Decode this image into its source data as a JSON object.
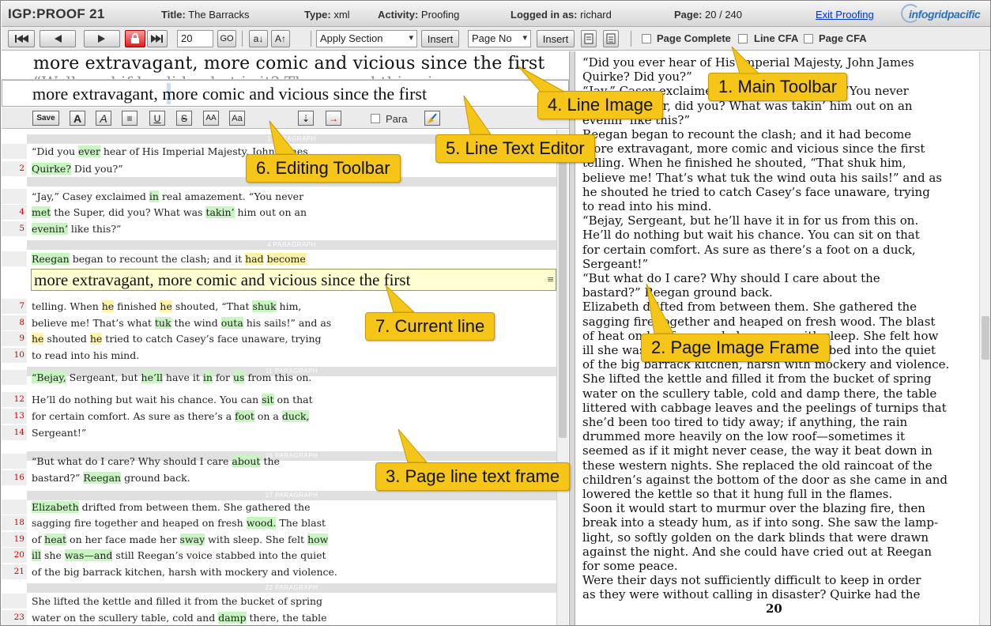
{
  "header": {
    "app_name": "IGP:PROOF 21",
    "title_label": "Title:",
    "title_value": "The Barracks",
    "type_label": "Type:",
    "type_value": "xml",
    "activity_label": "Activity:",
    "activity_value": "Proofing",
    "logged_label": "Logged in as:",
    "logged_value": "richard",
    "page_label": "Page:",
    "page_value": "20 / 240",
    "exit_link": "Exit Proofing",
    "logo_text": "infogridpacific"
  },
  "toolbar": {
    "first_icon": "first-page-icon",
    "prev_icon": "previous-page-icon",
    "next_icon": "next-page-icon",
    "lock_icon": "lock-icon",
    "last_icon": "last-page-icon",
    "page_input": "20",
    "go_label": "GO",
    "sort_asc_label": "a↓",
    "sort_up_label": "A↑",
    "apply_section": "Apply Section",
    "insert1": "Insert",
    "page_no": "Page No",
    "insert2": "Insert",
    "page_complete": "Page Complete",
    "line_cfa": "Line CFA",
    "page_cfa": "Page CFA"
  },
  "line_image": {
    "text": "more extravagant, more comic and vicious since the first",
    "ghost_text": "“Well, and if he did, what is it? The second thing is"
  },
  "line_editor": {
    "text_before": "more extravagant",
    "text_after": ", more comic and vicious since the first"
  },
  "edit_toolbar": {
    "save": "Save",
    "bold": "A",
    "italic": "A",
    "align": "≡",
    "underline": "U",
    "strike": "S",
    "smallcaps": "AA",
    "case": "Aa",
    "insert_below": "⇣",
    "indent": "→",
    "para_label": "Para"
  },
  "page_lines": {
    "para_labels": [
      "1 PARAGRAPH",
      "",
      "4 PARAGRAPH",
      "11 PARAGRAPH",
      "15 PARAGRAPH",
      "17 PARAGRAPH",
      "22 PARAGRAPH"
    ],
    "lines": [
      {
        "n": "",
        "segs": [
          [
            "“Did you ",
            ""
          ],
          [
            "ever",
            "hl"
          ],
          [
            " hear of His Imperial Majesty, John James",
            ""
          ]
        ]
      },
      {
        "n": "2",
        "segs": [
          [
            "Quirke?",
            "hl"
          ],
          [
            " Did you?”",
            ""
          ]
        ]
      },
      {
        "n": "",
        "segs": [
          [
            "“Jay,” Casey exclaimed ",
            ""
          ],
          [
            "in",
            "hl"
          ],
          [
            " real amazement. “You never",
            ""
          ]
        ]
      },
      {
        "n": "4",
        "segs": [
          [
            "met",
            "hl"
          ],
          [
            " the Super, did you? What was ",
            ""
          ],
          [
            "takin’",
            "hl"
          ],
          [
            " him out on an",
            ""
          ]
        ]
      },
      {
        "n": "5",
        "segs": [
          [
            "evenin’",
            "hl"
          ],
          [
            " like this?”",
            ""
          ]
        ]
      },
      {
        "n": "",
        "segs": [
          [
            "Reegan",
            "hl"
          ],
          [
            " began to recount the clash; and it ",
            ""
          ],
          [
            "had",
            "hy"
          ],
          [
            " ",
            ""
          ],
          [
            "become",
            "hy"
          ]
        ]
      },
      {
        "n": "7",
        "segs": [
          [
            "telling. When ",
            ""
          ],
          [
            "he",
            "hy"
          ],
          [
            " finished ",
            ""
          ],
          [
            "he",
            "hy"
          ],
          [
            " shouted, “That ",
            ""
          ],
          [
            "shuk",
            "hl"
          ],
          [
            " him,",
            ""
          ]
        ]
      },
      {
        "n": "8",
        "segs": [
          [
            "believe me! That’s what ",
            ""
          ],
          [
            "tuk",
            "hl"
          ],
          [
            " the wind ",
            ""
          ],
          [
            "outa",
            "hl"
          ],
          [
            " his sails!” and as",
            ""
          ]
        ]
      },
      {
        "n": "9",
        "segs": [
          [
            "he",
            "hy"
          ],
          [
            " shouted ",
            ""
          ],
          [
            "he",
            "hy"
          ],
          [
            " tried to catch Casey’s face unaware, trying",
            ""
          ]
        ]
      },
      {
        "n": "10",
        "segs": [
          [
            "to read into his mind.",
            ""
          ]
        ]
      },
      {
        "n": "",
        "segs": [
          [
            "“Bejay,",
            "hl"
          ],
          [
            " Sergeant, but ",
            ""
          ],
          [
            "he’ll",
            "hl"
          ],
          [
            " have it ",
            ""
          ],
          [
            "in",
            "hl"
          ],
          [
            " for ",
            ""
          ],
          [
            "us",
            "hl"
          ],
          [
            " from this on.",
            ""
          ]
        ]
      },
      {
        "n": "12",
        "segs": [
          [
            "He’ll do nothing but wait his chance. You can ",
            ""
          ],
          [
            "sit",
            "hl"
          ],
          [
            " on that",
            ""
          ]
        ]
      },
      {
        "n": "13",
        "segs": [
          [
            "for certain comfort. As sure as there’s a ",
            ""
          ],
          [
            "foot",
            "hl"
          ],
          [
            " on a ",
            ""
          ],
          [
            "duck,",
            "hl"
          ]
        ]
      },
      {
        "n": "14",
        "segs": [
          [
            "Sergeant!”",
            ""
          ]
        ]
      },
      {
        "n": "",
        "segs": [
          [
            "“But what do I care? Why should I care ",
            ""
          ],
          [
            "about",
            "hl"
          ],
          [
            " the",
            ""
          ]
        ]
      },
      {
        "n": "16",
        "segs": [
          [
            "bastard?” ",
            ""
          ],
          [
            "Reegan",
            "hl"
          ],
          [
            " ground back.",
            ""
          ]
        ]
      },
      {
        "n": "",
        "segs": [
          [
            "Elizabeth",
            "hl"
          ],
          [
            " drifted from between them. She gathered the",
            ""
          ]
        ]
      },
      {
        "n": "18",
        "segs": [
          [
            "sagging fire together and heaped on fresh ",
            ""
          ],
          [
            "wood.",
            "hl"
          ],
          [
            " The blast",
            ""
          ]
        ]
      },
      {
        "n": "19",
        "segs": [
          [
            "of ",
            ""
          ],
          [
            "heat",
            "hl"
          ],
          [
            " on her face made her ",
            ""
          ],
          [
            "sway",
            "hl"
          ],
          [
            " with sleep. She felt ",
            ""
          ],
          [
            "how",
            "hl"
          ]
        ]
      },
      {
        "n": "20",
        "segs": [
          [
            "ill",
            "hl"
          ],
          [
            " she ",
            ""
          ],
          [
            "was—and",
            "hl"
          ],
          [
            " still Reegan’s voice stabbed into the quiet",
            ""
          ]
        ]
      },
      {
        "n": "21",
        "segs": [
          [
            "of the big barrack kitchen, harsh with mockery and violence.",
            ""
          ]
        ]
      },
      {
        "n": "",
        "segs": [
          [
            "She lifted the kettle and filled it from the bucket of spring",
            ""
          ]
        ]
      },
      {
        "n": "23",
        "segs": [
          [
            "water on the scullery table, cold and ",
            ""
          ],
          [
            "damp",
            "hl"
          ],
          [
            " there, the table",
            ""
          ]
        ]
      }
    ],
    "current_line": "more extravagant, more comic and vicious since the first"
  },
  "page_image": {
    "lines": [
      "   “Did you ever hear of His Imperial Majesty, John James",
      "Quirke? Did you?”",
      "   “Jay,” Casey exclaimed in real amazement. “You never",
      "met the Super, did you? What was takin’ him out on an",
      "evenin’ like this?”",
      "   Reegan began to recount the clash; and it had become",
      "more extravagant, more comic and vicious since the first",
      "telling. When he finished he shouted, “That shuk him,",
      "believe me! That’s what tuk the wind outa his sails!” and as",
      "he shouted he tried to catch Casey’s face unaware, trying",
      "to read into his mind.",
      "   “Bejay, Sergeant, but he’ll have it in for us from this on.",
      "He’ll do nothing but wait his chance. You can sit on that",
      "for certain comfort. As sure as there’s a foot on a duck,",
      "Sergeant!”",
      "   “But what do I care? Why should I care about the",
      "bastard?” Reegan ground back.",
      "   Elizabeth drifted from between them. She gathered the",
      "sagging fire together and heaped on fresh wood. The blast",
      "of heat on her face made her sway with sleep. She felt how",
      "ill she was—and still Reegan’s voice stabbed into the quiet",
      "of the big barrack kitchen, harsh with mockery and violence.",
      "   She lifted the kettle and filled it from the bucket of spring",
      "water on the scullery table, cold and damp there, the table",
      "littered with cabbage leaves and the peelings of turnips that",
      "she’d been too tired to tidy away; if anything, the rain",
      "drummed more heavily on the low roof—sometimes it",
      "seemed as if it might never cease, the way it beat down in",
      "these western nights. She replaced the old raincoat of the",
      "children’s against the bottom of the door as she came in and",
      "lowered the kettle so that it hung full in the flames.",
      "   Soon it would start to murmur over the blazing fire, then",
      "break into a steady hum, as if into song. She saw the lamp-",
      "light, so softly golden on the dark blinds that were drawn",
      "against the night. And she could have cried out at Reegan",
      "for some peace.",
      "   Were their days not sufficiently difficult to keep in order",
      "as they were without calling in disaster? Quirke had the"
    ],
    "page_number": "20"
  },
  "callouts": {
    "c1": "1. Main Toolbar",
    "c2": "2. Page Image Frame",
    "c3": "3. Page line text frame",
    "c4": "4. Line Image",
    "c5": "5. Line Text Editor",
    "c6": "6. Editing Toolbar",
    "c7": "7. Current line"
  },
  "colors": {
    "callout": "#f5c518",
    "highlight_green": "#c8f5c1",
    "highlight_yellow": "#fff3a8",
    "line_number": "#cc0000"
  }
}
